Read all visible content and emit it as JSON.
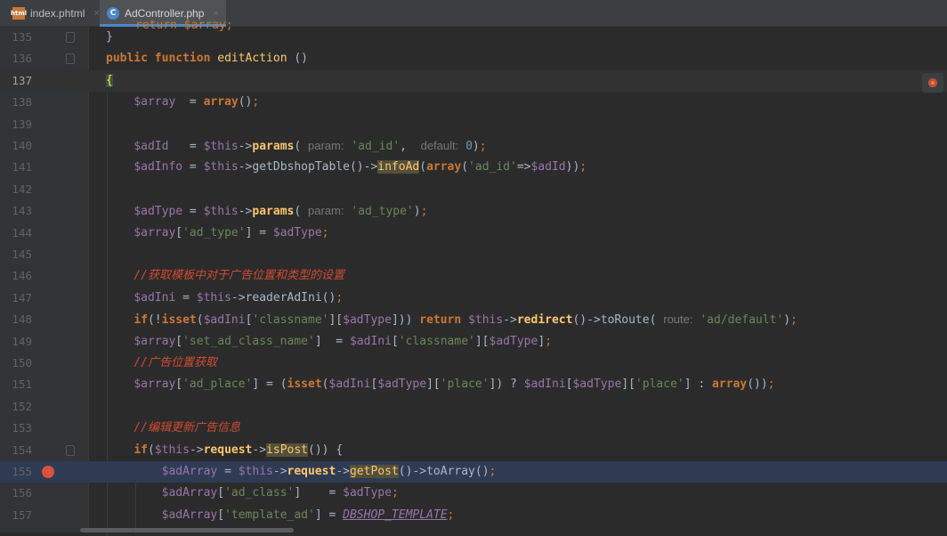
{
  "tabs": [
    {
      "label": "index.phtml",
      "close": "×",
      "icon_text": "html"
    },
    {
      "label": "AdController.php",
      "close": "×",
      "icon_text": "C"
    }
  ],
  "colors": {
    "background": "#2b2b2b",
    "keyword": "#cc7832",
    "string": "#6a8759",
    "variable": "#9876aa",
    "function": "#ffc66d",
    "comment": "#d04b32",
    "breakpoint": "#d6523d",
    "active_tab": "#4a88c7"
  },
  "icons": {
    "html_file": "html-file-icon",
    "php_class": "php-class-icon",
    "breakpoint": "breakpoint-icon",
    "fold": "fold-icon",
    "browser": "chrome-browser-icon"
  },
  "editor": {
    "caret_line": "137",
    "breakpoint_line": "155",
    "lines": [
      {
        "n": "135",
        "code": "}"
      },
      {
        "n": "136",
        "code": "public function editAction ()"
      },
      {
        "n": "137",
        "code": "{"
      },
      {
        "n": "138",
        "code": "    $array  = array();"
      },
      {
        "n": "139",
        "code": ""
      },
      {
        "n": "140",
        "code": "    $adId   = $this->params( param: 'ad_id',  default: 0);"
      },
      {
        "n": "141",
        "code": "    $adInfo = $this->getDbshopTable()->infoAd(array('ad_id'=>$adId));"
      },
      {
        "n": "142",
        "code": ""
      },
      {
        "n": "143",
        "code": "    $adType = $this->params( param: 'ad_type');"
      },
      {
        "n": "144",
        "code": "    $array['ad_type'] = $adType;"
      },
      {
        "n": "145",
        "code": ""
      },
      {
        "n": "146",
        "code": "    //获取模板中对于广告位置和类型的设置"
      },
      {
        "n": "147",
        "code": "    $adIni = $this->readerAdIni();"
      },
      {
        "n": "148",
        "code": "    if(!isset($adIni['classname'][$adType])) return $this->redirect()->toRoute( route: 'ad/default');"
      },
      {
        "n": "149",
        "code": "    $array['set_ad_class_name']  = $adIni['classname'][$adType];"
      },
      {
        "n": "150",
        "code": "    //广告位置获取"
      },
      {
        "n": "151",
        "code": "    $array['ad_place'] = (isset($adIni[$adType]['place']) ? $adIni[$adType]['place'] : array());"
      },
      {
        "n": "152",
        "code": ""
      },
      {
        "n": "153",
        "code": "    //编辑更新广告信息"
      },
      {
        "n": "154",
        "code": "    if($this->request->isPost()) {"
      },
      {
        "n": "155",
        "code": "        $adArray = $this->request->getPost()->toArray();"
      },
      {
        "n": "156",
        "code": "        $adArray['ad_class']    = $adType;"
      },
      {
        "n": "157",
        "code": "        $adArray['template_ad'] = DBSHOP_TEMPLATE;"
      }
    ]
  }
}
